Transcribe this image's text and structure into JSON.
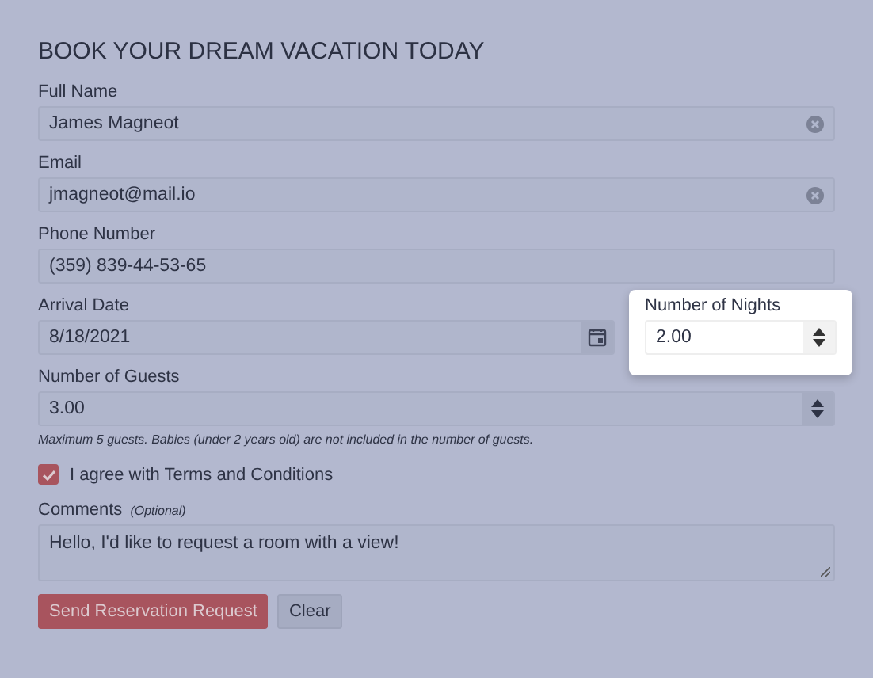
{
  "title": "BOOK YOUR DREAM VACATION TODAY",
  "full_name": {
    "label": "Full Name",
    "value": "James Magneot",
    "clearable": true
  },
  "email": {
    "label": "Email",
    "value": "jmagneot@mail.io",
    "clearable": true
  },
  "phone": {
    "label": "Phone Number",
    "value": "(359) 839-44-53-65",
    "clearable": false
  },
  "arrival_date": {
    "label": "Arrival Date",
    "value": "8/18/2021"
  },
  "nights": {
    "label": "Number of Nights",
    "value": "2.00",
    "highlighted": true
  },
  "guests": {
    "label": "Number of Guests",
    "value": "3.00",
    "hint": "Maximum 5 guests. Babies (under 2 years old) are not included in the number of guests."
  },
  "terms": {
    "label": "I agree with Terms and Conditions",
    "checked": true
  },
  "comments": {
    "label": "Comments",
    "note": "(Optional)",
    "value": "Hello, I'd like to request a room with a view!"
  },
  "buttons": [
    {
      "label": "Send Reservation Request",
      "kind": "primary"
    },
    {
      "label": "Clear",
      "kind": "secondary"
    }
  ]
}
